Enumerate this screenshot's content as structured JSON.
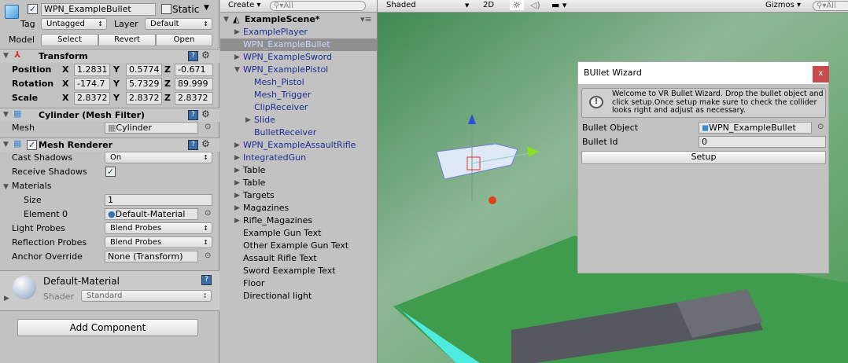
{
  "inspector": {
    "object_name": "WPN_ExampleBullet",
    "static_label": "Static",
    "tag_label": "Tag",
    "tag_value": "Untagged",
    "layer_label": "Layer",
    "layer_value": "Default",
    "model_label": "Model",
    "select": "Select",
    "revert": "Revert",
    "open": "Open",
    "transform": {
      "title": "Transform",
      "rows": [
        {
          "label": "Position",
          "x": "1.2831",
          "y": "0.5774",
          "z": "-0.671"
        },
        {
          "label": "Rotation",
          "x": "-174.7",
          "y": "5.7329",
          "z": "89.999"
        },
        {
          "label": "Scale",
          "x": "2.8372",
          "y": "2.8372",
          "z": "2.8372"
        }
      ]
    },
    "mesh_filter": {
      "title": "Cylinder (Mesh Filter)",
      "mesh_label": "Mesh",
      "mesh_value": "Cylinder"
    },
    "mesh_renderer": {
      "title": "Mesh Renderer",
      "cast_shadows_label": "Cast Shadows",
      "cast_shadows": "On",
      "receive_shadows_label": "Receive Shadows",
      "materials_label": "Materials",
      "size_label": "Size",
      "size": "1",
      "element0_label": "Element 0",
      "element0": "Default-Material",
      "light_probes_label": "Light Probes",
      "light_probes": "Blend Probes",
      "reflection_probes_label": "Reflection Probes",
      "reflection_probes": "Blend Probes",
      "anchor_label": "Anchor Override",
      "anchor": "None (Transform)"
    },
    "material": {
      "name": "Default-Material",
      "shader_label": "Shader",
      "shader": "Standard"
    },
    "add_component": "Add Component",
    "axis": {
      "x": "X",
      "y": "Y",
      "z": "Z"
    }
  },
  "hierarchy": {
    "create": "Create",
    "search_placeholder": "All",
    "scene": "ExampleScene*",
    "items": [
      {
        "label": "ExamplePlayer",
        "indent": 1,
        "arrow": "right",
        "prefab": true
      },
      {
        "label": "WPN_ExampleBullet",
        "indent": 1,
        "arrow": "",
        "prefab": true,
        "selected": true
      },
      {
        "label": "WPN_ExampleSword",
        "indent": 1,
        "arrow": "right",
        "prefab": true
      },
      {
        "label": "WPN_ExamplePistol",
        "indent": 1,
        "arrow": "down",
        "prefab": true
      },
      {
        "label": "Mesh_Pistol",
        "indent": 2,
        "arrow": "",
        "prefab": true
      },
      {
        "label": "Mesh_Trigger",
        "indent": 2,
        "arrow": "",
        "prefab": true
      },
      {
        "label": "ClipReceiver",
        "indent": 2,
        "arrow": "",
        "prefab": true
      },
      {
        "label": "Slide",
        "indent": 2,
        "arrow": "right",
        "prefab": true
      },
      {
        "label": "BulletReceiver",
        "indent": 2,
        "arrow": "",
        "prefab": true
      },
      {
        "label": "WPN_ExampleAssaultRifle",
        "indent": 1,
        "arrow": "right",
        "prefab": true
      },
      {
        "label": "IntegratedGun",
        "indent": 1,
        "arrow": "right",
        "prefab": true
      },
      {
        "label": "Table",
        "indent": 1,
        "arrow": "right",
        "prefab": false
      },
      {
        "label": "Table",
        "indent": 1,
        "arrow": "right",
        "prefab": false
      },
      {
        "label": "Targets",
        "indent": 1,
        "arrow": "right",
        "prefab": false
      },
      {
        "label": "Magazines",
        "indent": 1,
        "arrow": "right",
        "prefab": false
      },
      {
        "label": "Rifle_Magazines",
        "indent": 1,
        "arrow": "right",
        "prefab": false
      },
      {
        "label": "Example Gun Text",
        "indent": 1,
        "arrow": "",
        "prefab": false
      },
      {
        "label": "Other Example Gun Text",
        "indent": 1,
        "arrow": "",
        "prefab": false
      },
      {
        "label": "Assault Rifle Text",
        "indent": 1,
        "arrow": "",
        "prefab": false
      },
      {
        "label": "Sword Eexample Text",
        "indent": 1,
        "arrow": "",
        "prefab": false
      },
      {
        "label": "Floor",
        "indent": 1,
        "arrow": "",
        "prefab": false
      },
      {
        "label": "Directional light",
        "indent": 1,
        "arrow": "",
        "prefab": false
      }
    ]
  },
  "scene_toolbar": {
    "shading": "Shaded",
    "mode_2d": "2D",
    "gizmos": "Gizmos",
    "search_placeholder": "All"
  },
  "wizard": {
    "title": "BUllet Wizard",
    "close": "x",
    "message": "Welcome to VR Bullet Wizard. Drop the bullet object and click setup.Once setup make sure to check the collider looks right and adjust as necessary.",
    "bullet_object_label": "Bullet Object",
    "bullet_object": "WPN_ExampleBullet",
    "bullet_id_label": "Bullet Id",
    "bullet_id": "0",
    "setup": "Setup"
  }
}
